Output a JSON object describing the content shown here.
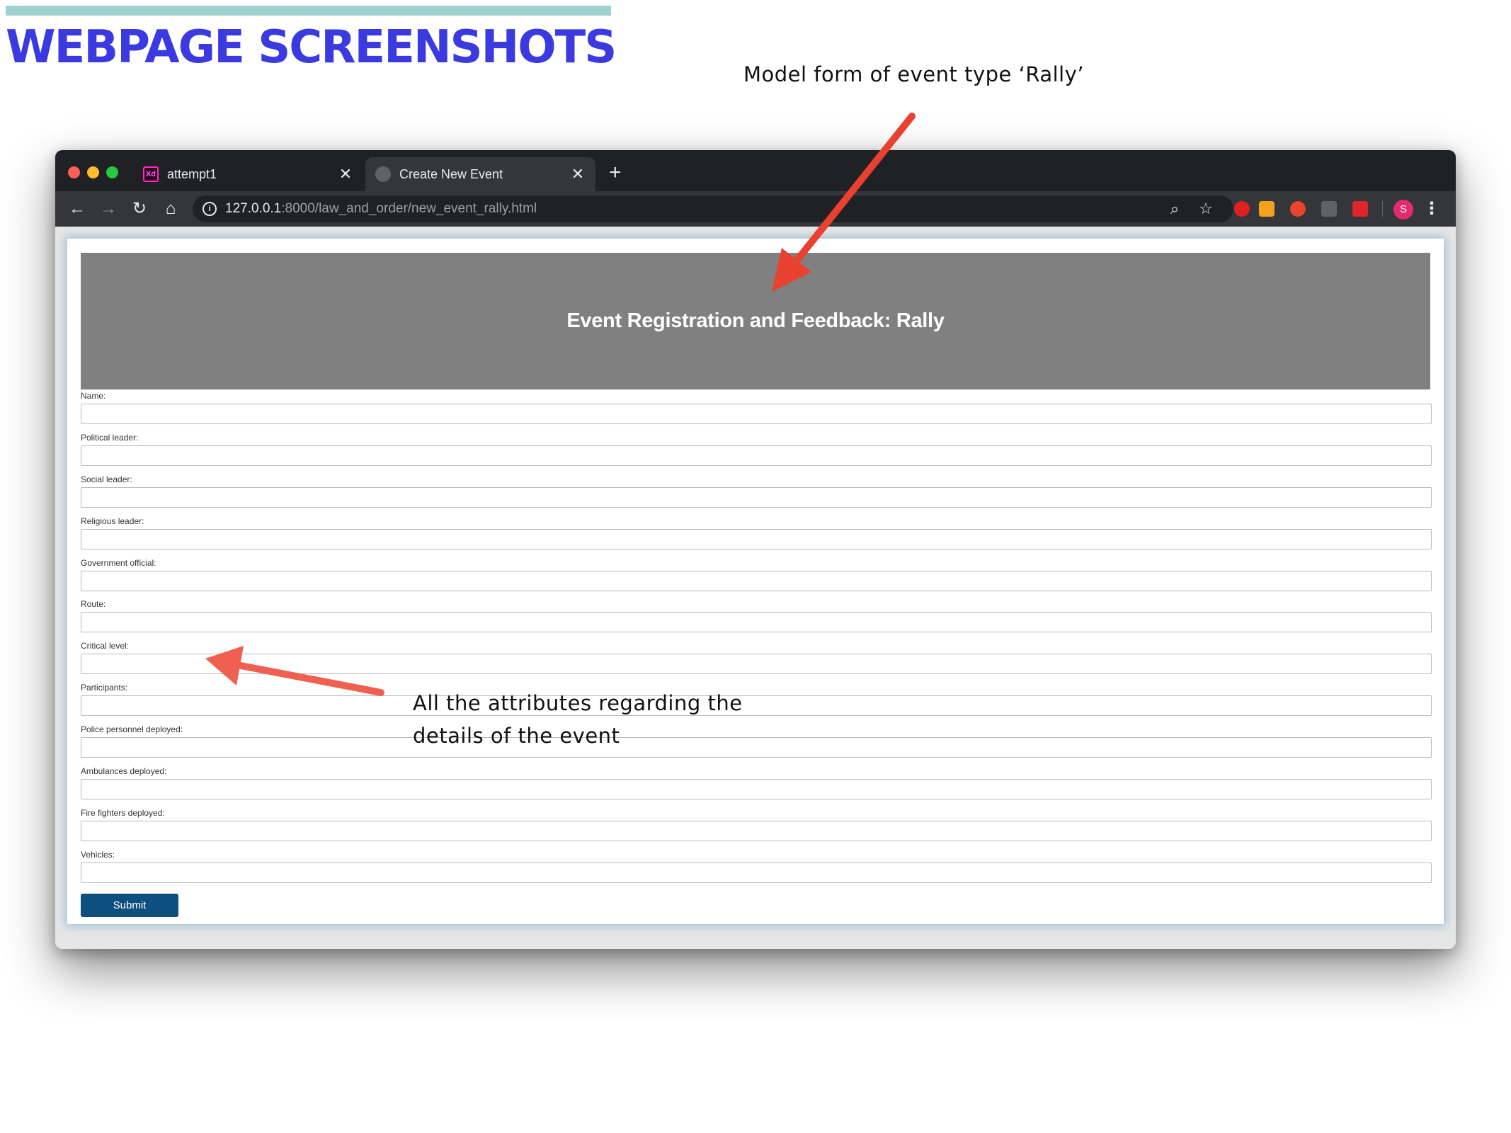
{
  "slide": {
    "title": "WEBPAGE SCREENSHOTS",
    "annotation_top": "Model form of event type ‘Rally’",
    "annotation_bottom_line1": "All the attributes regarding the",
    "annotation_bottom_line2": "details of the event",
    "accent_color": "#3a3ae0",
    "arrow_color": "#e8412f"
  },
  "browser": {
    "tabs": [
      {
        "label": "attempt1",
        "icon": "xd-icon",
        "icon_text": "Xd"
      },
      {
        "label": "Create New Event",
        "icon": "globe-icon",
        "active": true
      }
    ],
    "new_tab_symbol": "+",
    "close_symbol": "✕",
    "url_host": "127.0.0.1",
    "url_rest": ":8000/law_and_order/new_event_rally.html",
    "profile_initial": "S"
  },
  "page": {
    "header_title": "Event Registration and Feedback: Rally",
    "fields": [
      {
        "label": "Name:",
        "value": ""
      },
      {
        "label": "Political leader:",
        "value": ""
      },
      {
        "label": "Social leader:",
        "value": ""
      },
      {
        "label": "Religious leader:",
        "value": ""
      },
      {
        "label": "Government official:",
        "value": ""
      },
      {
        "label": "Route:",
        "value": ""
      },
      {
        "label": "Critical level:",
        "value": ""
      },
      {
        "label": "Participants:",
        "value": ""
      },
      {
        "label": "Police personnel deployed:",
        "value": ""
      },
      {
        "label": "Ambulances deployed:",
        "value": ""
      },
      {
        "label": "Fire fighters deployed:",
        "value": ""
      },
      {
        "label": "Vehicles:",
        "value": ""
      }
    ],
    "submit_label": "Submit"
  }
}
